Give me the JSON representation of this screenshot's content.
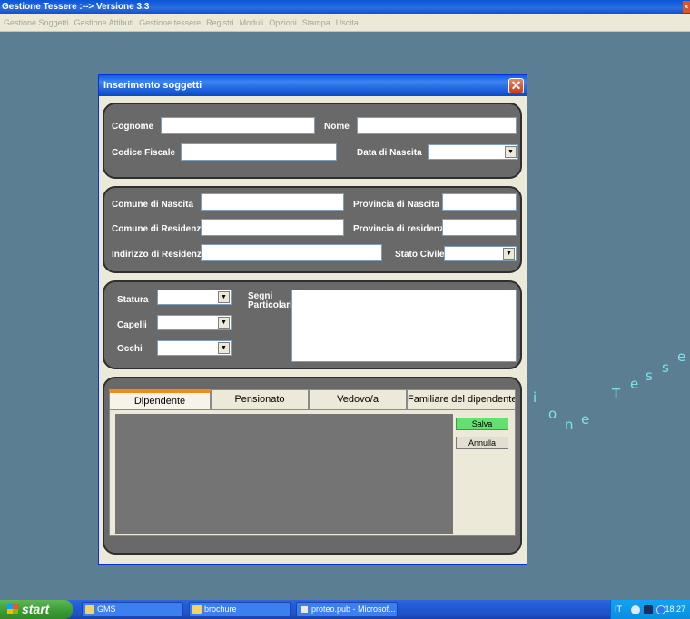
{
  "app": {
    "title": "Gestione Tessere :--> Versione 3.3",
    "close_glyph": "×",
    "menu": [
      "Gestione Soggetti",
      "Gestione Attibuti",
      "Gestione tessere",
      "Registri",
      "Moduli",
      "Opzioni",
      "Stampa",
      "Uscita"
    ]
  },
  "dialog": {
    "title": "Inserimento soggetti",
    "close_glyph": "✕",
    "anagrafica": {
      "cognome_label": "Cognome",
      "cognome_value": "",
      "nome_label": "Nome",
      "nome_value": "",
      "codice_fiscale_label": "Codice Fiscale",
      "codice_fiscale_value": "",
      "data_nascita_label": "Data di Nascita",
      "data_nascita_value": ""
    },
    "residenza": {
      "comune_nascita_label": "Comune di Nascita",
      "provincia_nascita_label": "Provincia di Nascita",
      "comune_residenza_label": "Comune di Residenza",
      "provincia_residenza_label": "Provincia di residenza",
      "indirizzo_label": "Indirizzo di Residenza",
      "stato_civile_label": "Stato Civile",
      "stato_civile_value": ""
    },
    "fisico": {
      "statura_label": "Statura",
      "capelli_label": "Capelli",
      "occhi_label": "Occhi",
      "segni_label_1": "Segni",
      "segni_label_2": "Particolari"
    },
    "tabs": [
      {
        "label": "Dipendente",
        "active": true
      },
      {
        "label": "Pensionato",
        "active": false
      },
      {
        "label": "Vedovo/a",
        "active": false
      },
      {
        "label": "Familiare del dipendente",
        "active": false
      }
    ],
    "buttons": {
      "save": "Salva",
      "cancel": "Annulla"
    }
  },
  "desktop": {
    "deco_letters": [
      "i",
      "o",
      "n",
      "e",
      "T",
      "e",
      "s",
      "s",
      "e"
    ]
  },
  "taskbar": {
    "start": "start",
    "tasks": [
      {
        "label": "GMS",
        "icon": "folder-icon"
      },
      {
        "label": "brochure",
        "icon": "folder-icon"
      },
      {
        "label": "proteo.pub - Microsof...",
        "icon": "publisher-icon"
      }
    ],
    "lang": "IT",
    "clock": "18.27"
  },
  "colors": {
    "desktop": "#5b7e92",
    "group_fill": "#6a6969",
    "active_tab_accent": "#f08c1c",
    "save_button": "#63e06f"
  }
}
